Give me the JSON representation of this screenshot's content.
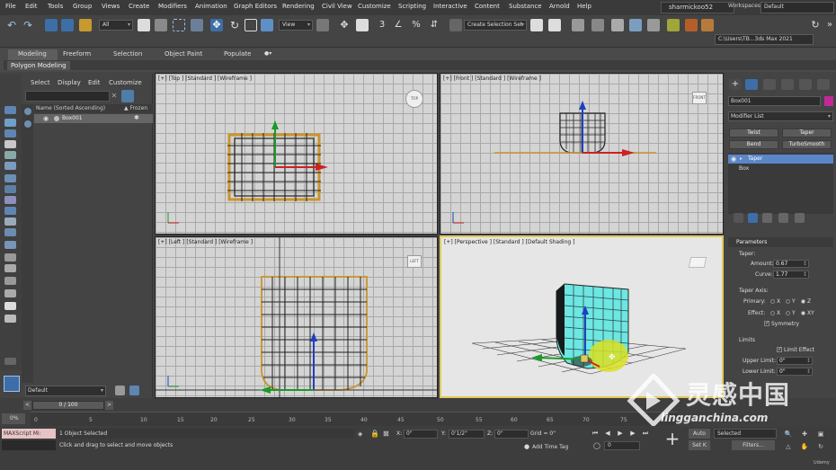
{
  "menu": [
    "File",
    "Edit",
    "Tools",
    "Group",
    "Views",
    "Create",
    "Modifiers",
    "Animation",
    "Graph Editors",
    "Rendering",
    "Civil View",
    "Customize",
    "Scripting",
    "Interactive",
    "Content",
    "Substance",
    "Arnold",
    "Help"
  ],
  "account": "sharmickoo52",
  "workspace": {
    "label": "Workspaces:",
    "value": "Default"
  },
  "toolbar": {
    "filter_all": "All",
    "view_sel": "View",
    "create_selection_set": "Create Selection Set",
    "path": "C:\\Users\\TB...3ds Max 2021"
  },
  "ribbon": {
    "tabs": [
      "Modeling",
      "Freeform",
      "Selection",
      "Object Paint",
      "Populate"
    ],
    "sub": "Polygon Modeling"
  },
  "explorer": {
    "menu": [
      "Select",
      "Display",
      "Edit",
      "Customize"
    ],
    "col_name": "Name (Sorted Ascending)",
    "col_frozen": "▲ Frozen",
    "row": "Box001",
    "layer": "Default"
  },
  "viewports": {
    "top": "[+] [Top ] [Standard ] [Wireframe ]",
    "front": "[+] [Front ] [Standard ] [Wireframe ]",
    "left": "[+] [Left ] [Standard ] [Wireframe ]",
    "perspective": "[+] [Perspective ] [Standard ] [Default Shading ]",
    "cube_top": "TOP",
    "cube_front": "FRONT",
    "cube_left": "LEFT"
  },
  "command_panel": {
    "object_name": "Box001",
    "modifier_list": "Modifier List",
    "buttons": [
      "Twist",
      "Taper",
      "Bend",
      "TurboSmooth"
    ],
    "stack_active": "Taper",
    "stack_base": "Box",
    "params_header": "Parameters",
    "taper_label": "Taper:",
    "amount_label": "Amount:",
    "amount_value": "0.67",
    "curve_label": "Curve:",
    "curve_value": "1.77",
    "taper_axis": "Taper Axis:",
    "primary_label": "Primary:",
    "effect_label": "Effect:",
    "x": "X",
    "y": "Y",
    "z": "Z",
    "xy": "XY",
    "symmetry": "Symmetry",
    "limits": "Limits",
    "limit_effect": "Limit Effect",
    "upper_label": "Upper Limit:",
    "upper_value": "0\"",
    "lower_label": "Lower Limit:",
    "lower_value": "0\""
  },
  "timeline": {
    "frame": "0 / 100",
    "prev": "<",
    "next": ">",
    "ticks": [
      "0",
      "5",
      "10",
      "15",
      "20",
      "25",
      "30",
      "35",
      "40",
      "45",
      "50",
      "55",
      "60",
      "65",
      "70",
      "75"
    ],
    "pct": "0%"
  },
  "status": {
    "maxscript": "MAXScript Mi:",
    "line1": "1 Object Selected",
    "line2": "Click and drag to select and move objects",
    "x_label": "X:",
    "x_value": "0\"",
    "y_label": "Y:",
    "y_value": "0'1/2\"",
    "z_label": "Z:",
    "z_value": "0\"",
    "grid": "Grid = 0\"",
    "add_time_tag": "Add Time Tag",
    "frame_num": "0",
    "auto": "Auto",
    "set_k": "Set K",
    "selected": "Selected",
    "filters": "Filters..."
  },
  "watermark": {
    "cn": "灵感中国",
    "en": "lingganchina.com",
    "udemy": "Udemy"
  }
}
